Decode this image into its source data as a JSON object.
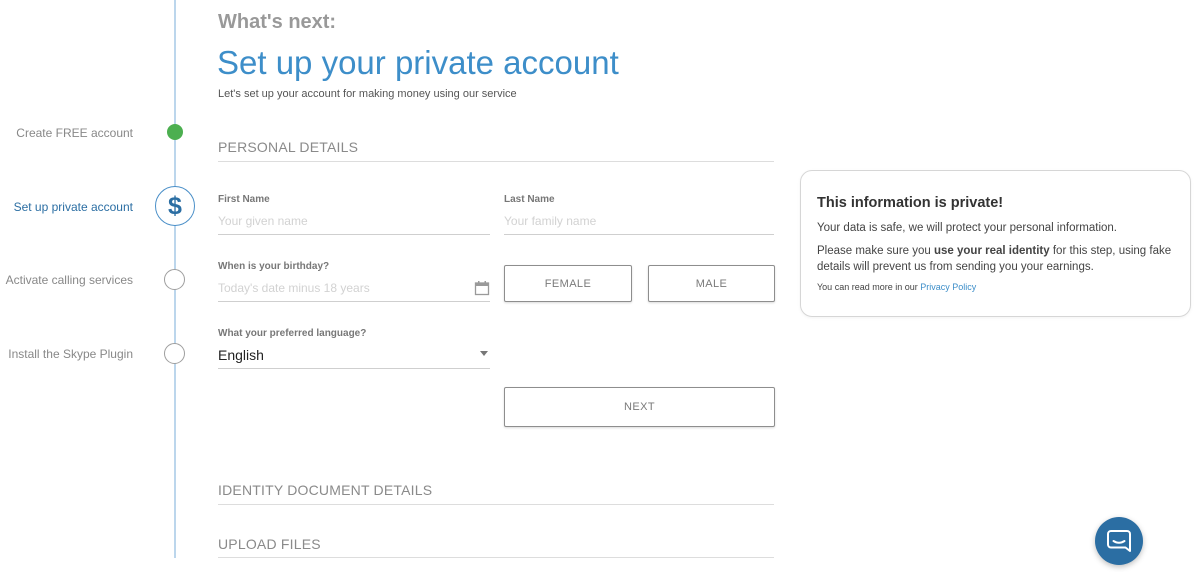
{
  "stepper": {
    "steps": [
      {
        "label": "Create FREE account",
        "state": "done"
      },
      {
        "label": "Set up private account",
        "state": "active"
      },
      {
        "label": "Activate calling services",
        "state": "todo"
      },
      {
        "label": "Install the Skype Plugin",
        "state": "todo"
      }
    ],
    "active_symbol": "$"
  },
  "header": {
    "whats_next": "What's next:",
    "title": "Set up your private account",
    "subtitle": "Let's set up your account for making money using our service"
  },
  "sections": {
    "personal": "PERSONAL DETAILS",
    "identity": "IDENTITY DOCUMENT DETAILS",
    "upload": "UPLOAD FILES"
  },
  "form": {
    "first_name": {
      "label": "First Name",
      "value": "",
      "placeholder": "Your given name"
    },
    "last_name": {
      "label": "Last Name",
      "value": "",
      "placeholder": "Your family name"
    },
    "birthday": {
      "label": "When is your birthday?",
      "value": "",
      "placeholder": "Today's date minus 18 years"
    },
    "gender": {
      "female": "FEMALE",
      "male": "MALE"
    },
    "language": {
      "label": "What your preferred language?",
      "selected": "English"
    },
    "next": "NEXT"
  },
  "info": {
    "title": "This information is private!",
    "p1": "Your data is safe, we will protect your personal information.",
    "p2_before": "Please make sure you ",
    "p2_bold": "use your real identity",
    "p2_after": " for this step, using fake details will prevent us from sending you your earnings.",
    "read_more": "You can read more in our ",
    "privacy_link": "Privacy Policy"
  },
  "colors": {
    "accent": "#3d8ec9",
    "done": "#4caf50",
    "chat": "#2b6ea3"
  }
}
